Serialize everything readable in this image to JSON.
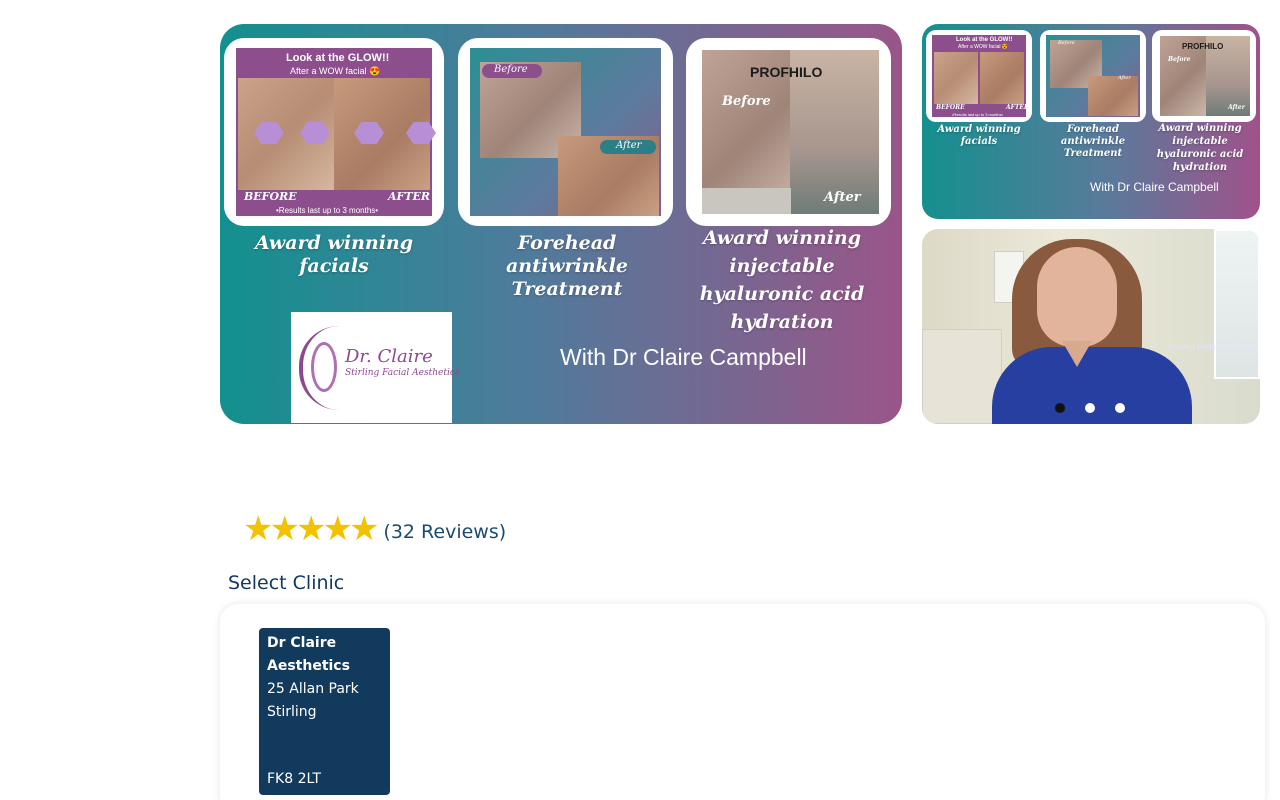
{
  "hero": {
    "main": {
      "panel1": {
        "headline": "Look at the GLOW!!",
        "subline": "After a WOW facial 😍",
        "before": "BEFORE",
        "after": "AFTER",
        "note": "•Results last up to 3 months•",
        "caption": "Award winning facials"
      },
      "panel2": {
        "before": "Before",
        "after": "After",
        "caption": "Forehead antiwrinkle Treatment"
      },
      "panel3": {
        "brand": "PROFHILO",
        "before": "Before",
        "after": "After",
        "caption": "Award winning injectable hyaluronic acid hydration"
      },
      "with_line": "With Dr Claire Campbell",
      "logo": {
        "name": "Dr. Claire",
        "sub": "Stirling Facial Aesthetics"
      }
    },
    "thumb": {
      "panel1": {
        "headline": "Look at the GLOW!!",
        "subline": "After a WOW facial 😍",
        "before": "BEFORE",
        "after": "AFTER",
        "note": "•Results last up to 3 months•",
        "caption": "Award winning facials"
      },
      "panel2": {
        "before": "Before",
        "after": "After",
        "caption": "Forehead antiwrinkle Treatment"
      },
      "panel3": {
        "brand": "PROFHILO",
        "before": "Before",
        "after": "After",
        "caption": "Award winning injectable hyaluronic acid hydration"
      },
      "with_line": "With Dr Claire Campbell"
    },
    "photo": {
      "badge": "Stirling Facial Aesthetics"
    },
    "carousel": {
      "count": 3,
      "active_index": 0
    }
  },
  "rating": {
    "stars": 5,
    "reviews_label": "(32 Reviews)"
  },
  "select_clinic": {
    "title": "Select Clinic",
    "clinics": [
      {
        "name": "Dr Claire Aesthetics",
        "address_line1": "25 Allan Park",
        "city": "Stirling",
        "postcode": "FK8 2LT"
      }
    ]
  },
  "colors": {
    "navy": "#113a5c",
    "star": "#f2c200",
    "teal": "#12908f",
    "purple": "#9a5588"
  }
}
